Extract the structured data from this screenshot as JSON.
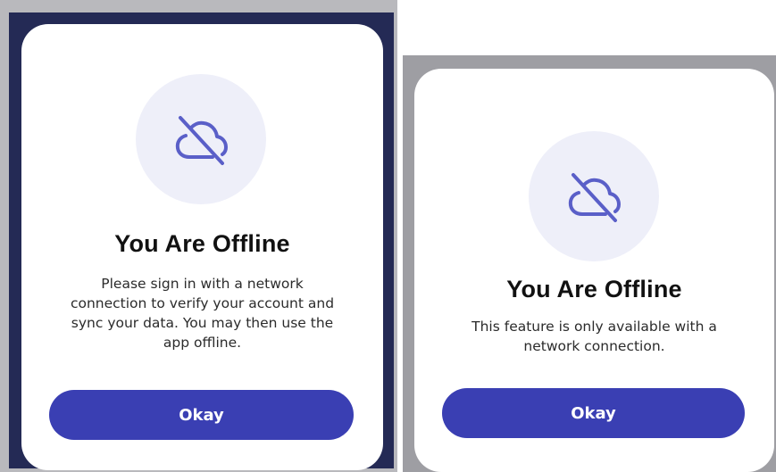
{
  "dialogs": [
    {
      "icon": "cloud-offline-icon",
      "title": "You Are Offline",
      "message_lines": [
        "Please sign in with a network",
        "connection to verify your account and",
        "sync your data. You may then use the",
        "app offline."
      ],
      "button_label": "Okay"
    },
    {
      "icon": "cloud-offline-icon",
      "title": "You Are Offline",
      "message_lines": [
        "This feature is only available with a",
        "network connection."
      ],
      "button_label": "Okay"
    }
  ],
  "colors": {
    "accent": "#3a3fb3",
    "icon_stroke": "#5a5fc8",
    "icon_circle": "#eeeff9",
    "left_backdrop": "#242a55",
    "left_frame": "#b9b9bd",
    "right_frame": "#9e9ea3"
  }
}
